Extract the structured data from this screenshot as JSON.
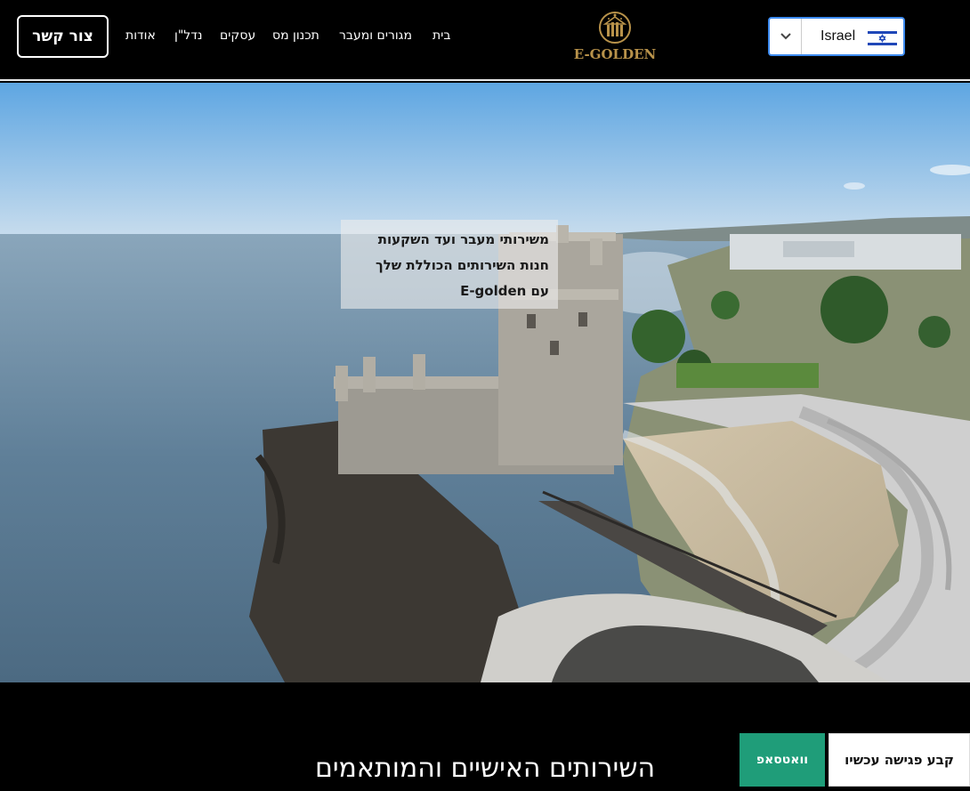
{
  "header": {
    "contact_label": "צור קשר",
    "nav": [
      "אודות",
      "נדל\"ן",
      "עסקים",
      "תכנון מס",
      "מגורים ומעבר",
      "בית"
    ],
    "logo_text": "E-GOLDEN",
    "country": {
      "selected": "Israel",
      "flag_icon": "israel-flag-icon"
    }
  },
  "hero": {
    "caption_lines": [
      "משירותי מעבר ועד השקעות",
      "חנות השירותים הכוללת שלך",
      "עם E-golden"
    ]
  },
  "section": {
    "title": "השירותים האישיים והמותאמים"
  },
  "cta": {
    "whatsapp_label": "וואטסאפ",
    "meeting_label": "קבע פגישה עכשיו"
  },
  "colors": {
    "accent_gold": "#b8924a",
    "whatsapp_green": "#1f9d79",
    "select_border": "#3d8bf0"
  }
}
